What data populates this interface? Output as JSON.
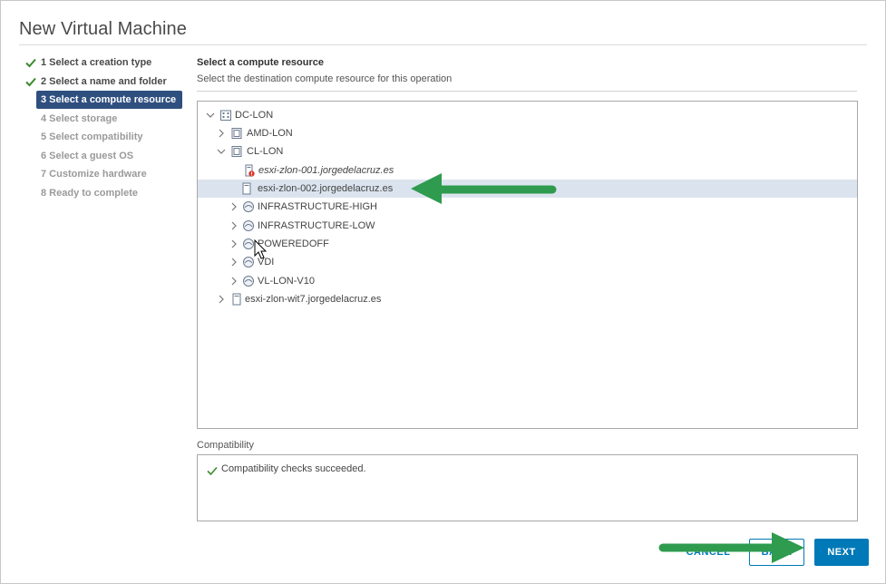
{
  "dialog": {
    "title": "New Virtual Machine"
  },
  "steps": [
    {
      "label": "1 Select a creation type",
      "state": "done"
    },
    {
      "label": "2 Select a name and folder",
      "state": "done"
    },
    {
      "label": "3 Select a compute resource",
      "state": "active"
    },
    {
      "label": "4 Select storage",
      "state": "pending"
    },
    {
      "label": "5 Select compatibility",
      "state": "pending"
    },
    {
      "label": "6 Select a guest OS",
      "state": "pending"
    },
    {
      "label": "7 Customize hardware",
      "state": "pending"
    },
    {
      "label": "8 Ready to complete",
      "state": "pending"
    }
  ],
  "content": {
    "title": "Select a compute resource",
    "subtitle": "Select the destination compute resource for this operation"
  },
  "tree": {
    "nodes": [
      {
        "label": "DC-LON",
        "icon": "datacenter-icon",
        "expanded": true
      },
      {
        "label": "AMD-LON",
        "icon": "cluster-icon",
        "expanded": false
      },
      {
        "label": "CL-LON",
        "icon": "cluster-icon",
        "expanded": true
      },
      {
        "label": "esxi-zlon-001.jorgedelacruz.es",
        "icon": "host-error-icon",
        "italic": true
      },
      {
        "label": "esxi-zlon-002.jorgedelacruz.es",
        "icon": "host-icon",
        "selected": true
      },
      {
        "label": "INFRASTRUCTURE-HIGH",
        "icon": "resource-pool-icon",
        "expanded": false
      },
      {
        "label": "INFRASTRUCTURE-LOW",
        "icon": "resource-pool-icon",
        "expanded": false
      },
      {
        "label": "POWEREDOFF",
        "icon": "resource-pool-icon",
        "expanded": false
      },
      {
        "label": "VDI",
        "icon": "resource-pool-icon",
        "expanded": false
      },
      {
        "label": "VL-LON-V10",
        "icon": "resource-pool-icon",
        "expanded": false
      },
      {
        "label": "esxi-zlon-wit7.jorgedelacruz.es",
        "icon": "host-icon",
        "expanded": false
      }
    ]
  },
  "compatibility": {
    "label": "Compatibility",
    "message": "Compatibility checks succeeded."
  },
  "buttons": {
    "cancel": "CANCEL",
    "back": "BACK",
    "next": "NEXT"
  },
  "colors": {
    "accent": "#0079b8",
    "active_step": "#2f4f7f",
    "selected_row": "#dbe4ee",
    "success": "#3c8a2e",
    "annotation_arrow": "#2e9b4f"
  }
}
